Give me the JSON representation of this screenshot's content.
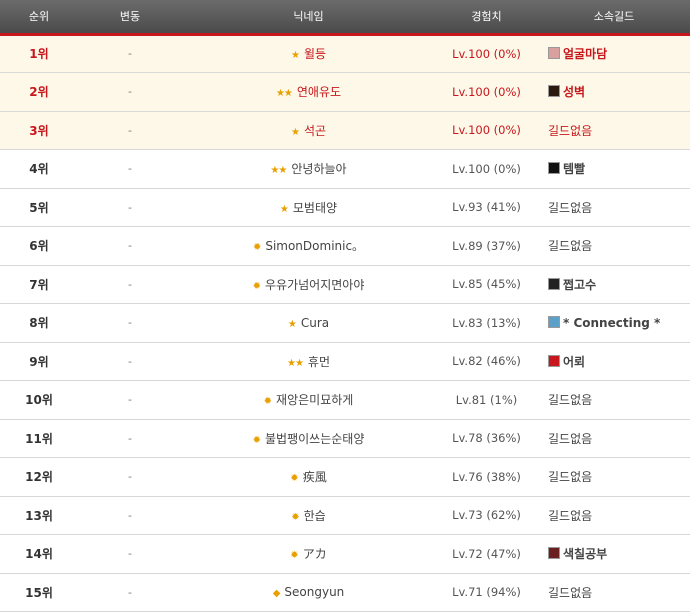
{
  "header": {
    "rank": "순위",
    "change": "변동",
    "nickname": "닉네임",
    "exp": "경험치",
    "guild": "소속길드"
  },
  "rows": [
    {
      "rank": "1위",
      "change": "-",
      "stars": "★",
      "nickname": "윌등",
      "exp": "Lv.100 (0%)",
      "guild": "얼굴마담",
      "guild_icon": true,
      "guild_icon_color": "#d9a0a0",
      "top": true
    },
    {
      "rank": "2위",
      "change": "-",
      "stars": "★★",
      "nickname": "연애유도",
      "exp": "Lv.100 (0%)",
      "guild": "성벽",
      "guild_icon": true,
      "guild_icon_color": "#2a1a10",
      "top": true
    },
    {
      "rank": "3위",
      "change": "-",
      "stars": "★",
      "nickname": "석곤",
      "exp": "Lv.100 (0%)",
      "guild": "길드없음",
      "guild_icon": false,
      "top": true
    },
    {
      "rank": "4위",
      "change": "-",
      "stars": "★★",
      "nickname": "안녕하늘아",
      "exp": "Lv.100 (0%)",
      "guild": "템빨",
      "guild_icon": true,
      "guild_icon_color": "#111111",
      "top": false
    },
    {
      "rank": "5위",
      "change": "-",
      "stars": "★",
      "nickname": "모범태양",
      "exp": "Lv.93 (41%)",
      "guild": "길드없음",
      "guild_icon": false,
      "top": false
    },
    {
      "rank": "6위",
      "change": "-",
      "stars": "✹",
      "nickname": "SimonDominic。",
      "exp": "Lv.89 (37%)",
      "guild": "길드없음",
      "guild_icon": false,
      "top": false
    },
    {
      "rank": "7위",
      "change": "-",
      "stars": "✹",
      "nickname": "우유가넘어지면아야",
      "exp": "Lv.85 (45%)",
      "guild": "쩝고수",
      "guild_icon": true,
      "guild_icon_color": "#222222",
      "top": false
    },
    {
      "rank": "8위",
      "change": "-",
      "stars": "★",
      "nickname": "Cura",
      "exp": "Lv.83 (13%)",
      "guild": "* Connecting *",
      "guild_icon": true,
      "guild_icon_color": "#5aa0c8",
      "top": false
    },
    {
      "rank": "9위",
      "change": "-",
      "stars": "★★",
      "nickname": "휴먼",
      "exp": "Lv.82 (46%)",
      "guild": "어뢰",
      "guild_icon": true,
      "guild_icon_color": "#c8171c",
      "top": false
    },
    {
      "rank": "10위",
      "change": "-",
      "stars": "✹",
      "nickname": "재앙은미묘하게",
      "exp": "Lv.81 (1%)",
      "guild": "길드없음",
      "guild_icon": false,
      "top": false
    },
    {
      "rank": "11위",
      "change": "-",
      "stars": "✹",
      "nickname": "불법팽이쓰는순태양",
      "exp": "Lv.78 (36%)",
      "guild": "길드없음",
      "guild_icon": false,
      "top": false
    },
    {
      "rank": "12위",
      "change": "-",
      "stars": "✹",
      "nickname": "疾風",
      "exp": "Lv.76 (38%)",
      "guild": "길드없음",
      "guild_icon": false,
      "top": false
    },
    {
      "rank": "13위",
      "change": "-",
      "stars": "✹",
      "nickname": "한습",
      "exp": "Lv.73 (62%)",
      "guild": "길드없음",
      "guild_icon": false,
      "top": false
    },
    {
      "rank": "14위",
      "change": "-",
      "stars": "✹",
      "nickname": "アカ",
      "exp": "Lv.72 (47%)",
      "guild": "색칠공부",
      "guild_icon": true,
      "guild_icon_color": "#6a2020",
      "top": false
    },
    {
      "rank": "15위",
      "change": "-",
      "stars": "◆",
      "nickname": "Seongyun",
      "exp": "Lv.71 (94%)",
      "guild": "길드없음",
      "guild_icon": false,
      "top": false
    }
  ],
  "colors": {
    "accent_red": "#c8171c",
    "header_bg": "#5a5a5a",
    "top_row_bg": "#fdf8e8",
    "star": "#e8a000"
  },
  "icons": {
    "rank_badge": "star-icon"
  }
}
